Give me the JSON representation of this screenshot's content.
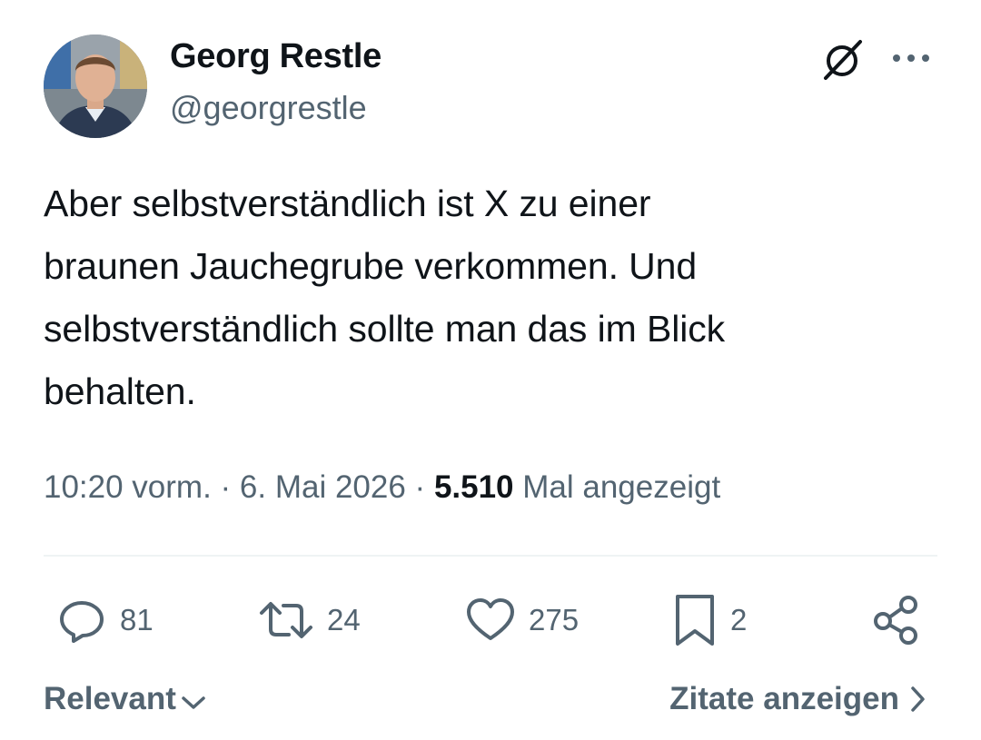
{
  "author": {
    "display_name": "Georg Restle",
    "handle": "@georgrestle"
  },
  "header": {
    "grok_icon": "grok-slash-icon",
    "more_icon": "more-dots-icon"
  },
  "tweet": {
    "text": "Aber selbstverständlich ist X zu einer\nbraunen Jauchegrube verkommen. Und\nselbstverständlich sollte man das im Blick\nbehalten."
  },
  "meta": {
    "time": "10:20 vorm.",
    "separator": " · ",
    "date": "6. Mai 2026",
    "views": "5.510",
    "views_label": " Mal angezeigt"
  },
  "actions": {
    "reply": {
      "icon": "reply-icon",
      "count": "81"
    },
    "retweet": {
      "icon": "retweet-icon",
      "count": "24"
    },
    "like": {
      "icon": "heart-icon",
      "count": "275"
    },
    "bookmark": {
      "icon": "bookmark-icon",
      "count": "2"
    },
    "share": {
      "icon": "share-icon"
    }
  },
  "footer": {
    "sort_label": "Relevant",
    "quotes_label": "Zitate anzeigen"
  },
  "colors": {
    "text_primary": "#0f1419",
    "text_secondary": "#536471",
    "divider": "#eff3f4"
  }
}
